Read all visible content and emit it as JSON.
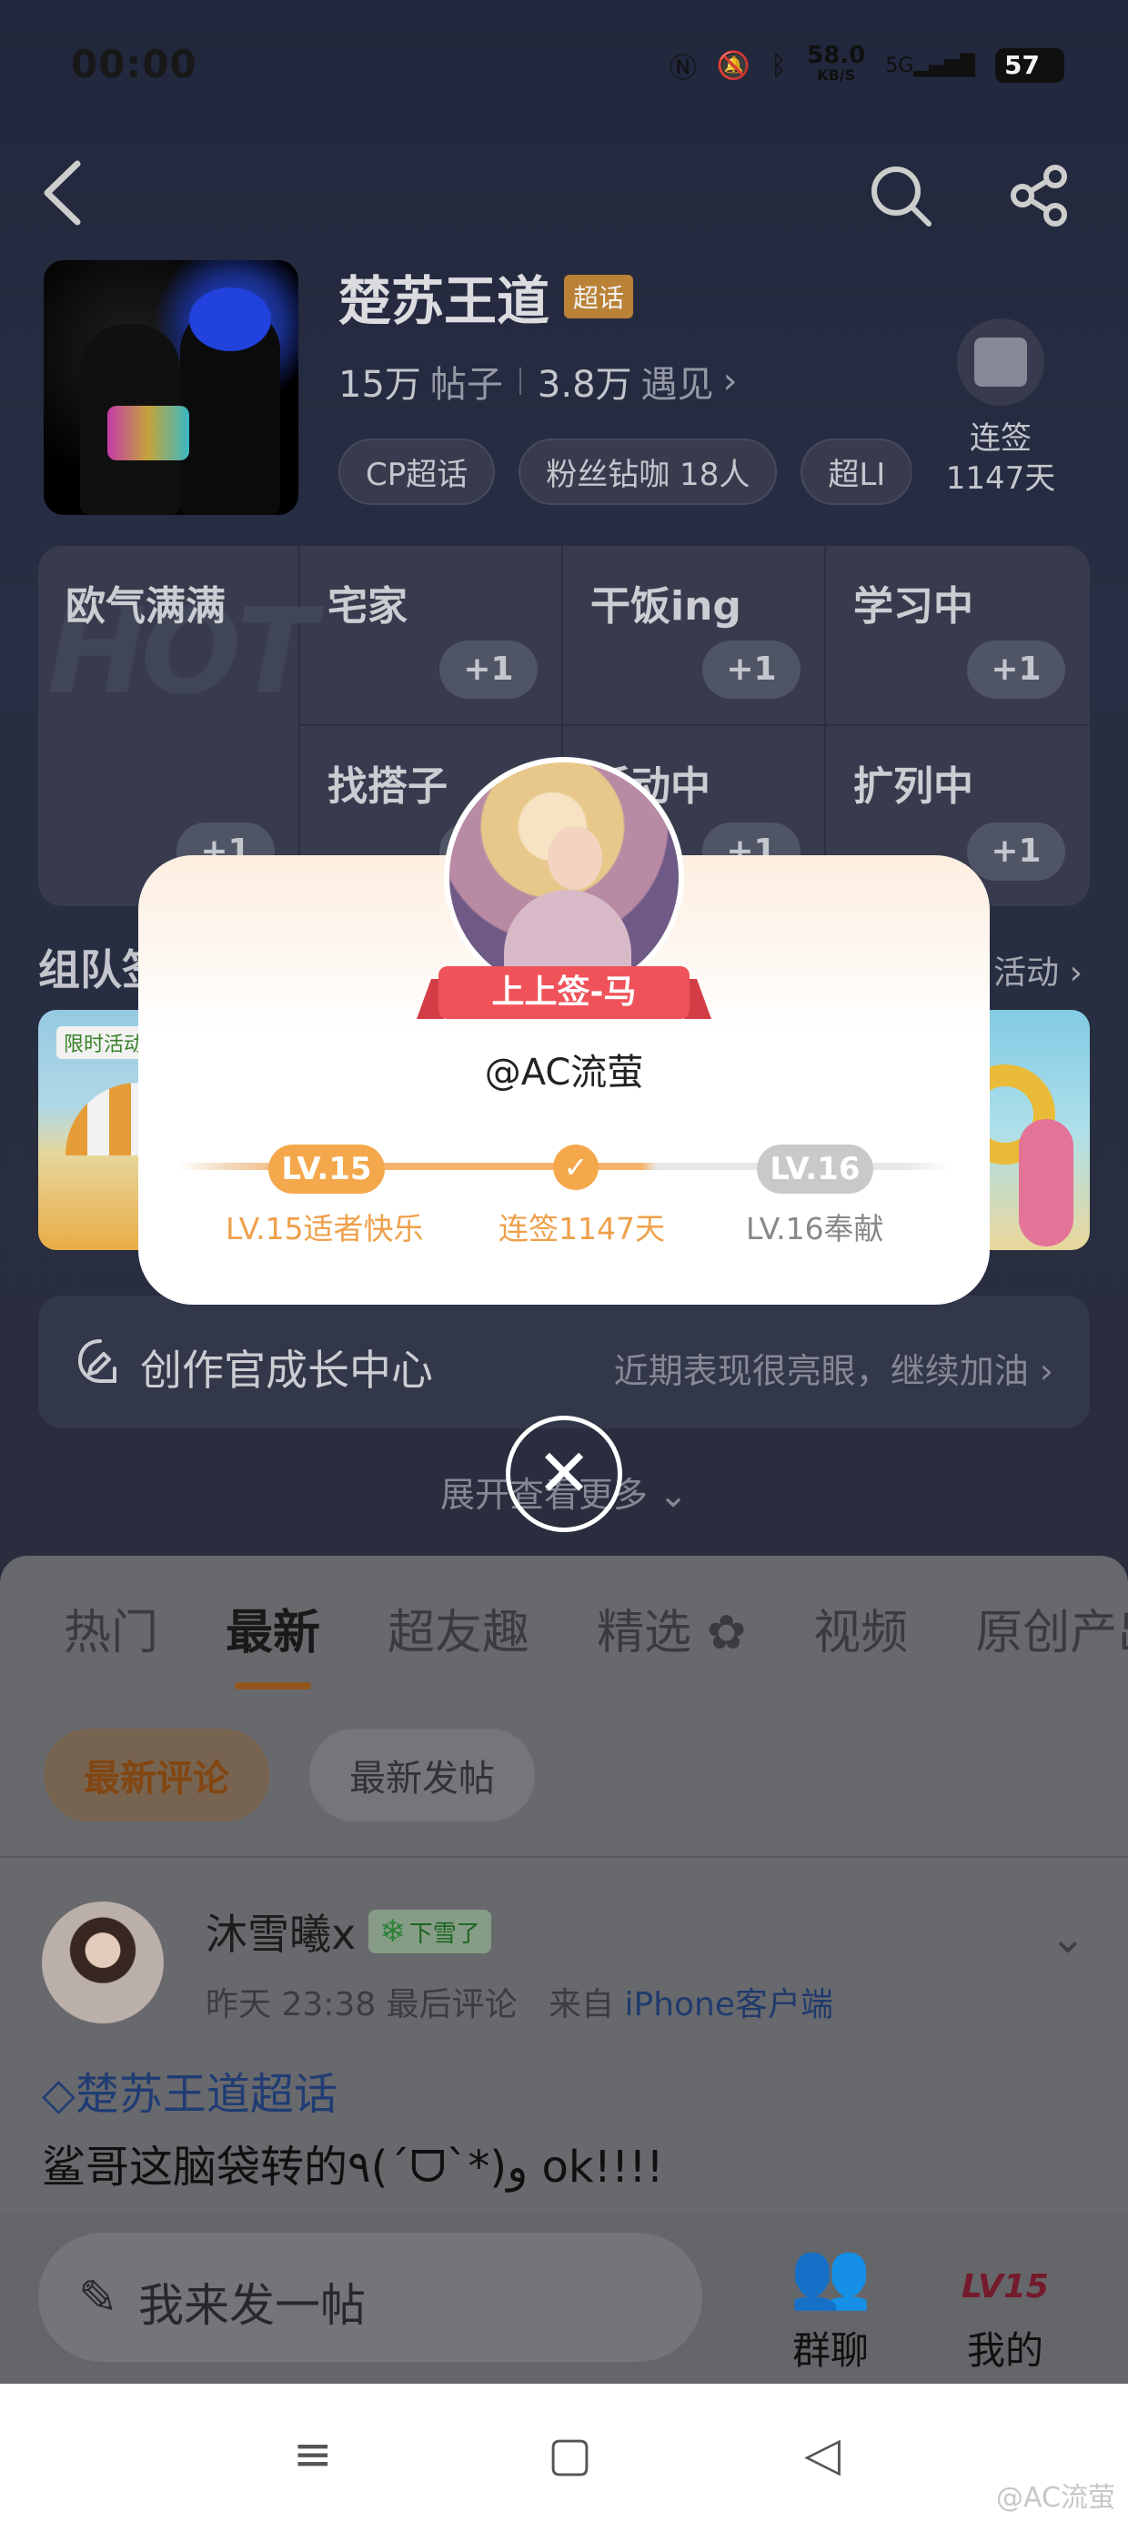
{
  "status": {
    "time": "00:00",
    "speed": "58.0",
    "speed_unit": "KB/S",
    "network": "5G",
    "battery": "57"
  },
  "header": {
    "title": "楚苏王道",
    "title_tag": "超话",
    "posts_count": "15万",
    "posts_label": "帖子",
    "encounters_count": "3.8万",
    "encounters_label": "遇见",
    "tags": [
      "CP超话",
      "粉丝钻咖 18人",
      "超LI"
    ],
    "checkin_label": "连签",
    "checkin_days": "1147天"
  },
  "mood": {
    "hot_watermark": "HOT",
    "big_label": "欧气满满",
    "cells": [
      {
        "label": "宅家",
        "btn": "+1"
      },
      {
        "label": "干饭ing",
        "btn": "+1"
      },
      {
        "label": "学习中",
        "btn": "+1"
      },
      {
        "label": "找搭子",
        "btn": "+1"
      },
      {
        "label": "活动中",
        "btn": "+1"
      },
      {
        "label": "扩列中",
        "btn": "+1"
      }
    ],
    "big_btn": "+1"
  },
  "section": {
    "title": "组队签",
    "more": "活动",
    "banner_ribbon": "限时活动"
  },
  "growth": {
    "title": "创作官成长中心",
    "subtitle": "近期表现很亮眼，继续加油"
  },
  "expand_label": "展开查看更多",
  "tabs": [
    "热门",
    "最新",
    "超友趣",
    "精选",
    "视频",
    "原创产出"
  ],
  "subtabs": [
    "最新评论",
    "最新发帖"
  ],
  "post": {
    "name": "沐雪曦x",
    "badge": "下雪了",
    "time": "昨天 23:38",
    "action": "最后评论",
    "from": "来自",
    "client": "iPhone客户端",
    "topic": "楚苏王道超话",
    "text": "鲨哥这脑袋转的٩(ˊᗜˋ*)و ok!!!!"
  },
  "bottom_bar": {
    "compose": "我来发一帖",
    "group_chat": "群聊",
    "mine": "我的",
    "mine_level": "LV15"
  },
  "modal": {
    "fortune": "上上签-马",
    "user": "@AC流萤",
    "current_level": "LV.15",
    "next_level": "LV.16",
    "current_caption": "LV.15适者快乐",
    "mid_caption": "连签1147天",
    "next_caption": "LV.16奉献",
    "progress": 0.58
  },
  "watermark": "@AC流萤"
}
